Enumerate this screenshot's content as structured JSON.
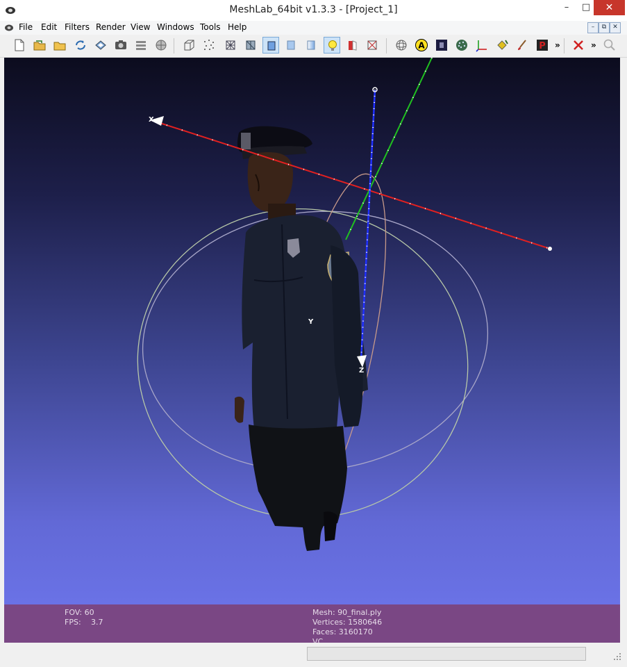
{
  "window": {
    "title": "MeshLab_64bit v1.3.3 - [Project_1]",
    "minimize_label": "–",
    "maximize_label": "□",
    "close_label": "✕"
  },
  "menu": {
    "items": [
      "File",
      "Edit",
      "Filters",
      "Render",
      "View",
      "Windows",
      "Tools",
      "Help"
    ]
  },
  "mdi_controls": [
    "–",
    "⧉",
    "✕"
  ],
  "toolbar": {
    "overflow_label": "»",
    "overflow_label_2": "»",
    "overflow_label_3": "»"
  },
  "viewport": {
    "axis_labels": {
      "x": "X",
      "y": "Y",
      "z": "Z"
    }
  },
  "info": {
    "fov": "FOV: 60",
    "fps_label": "FPS:",
    "fps_value": "3.7",
    "mesh": "Mesh: 90_final.ply",
    "vertices": "Vertices: 1580646",
    "faces": "Faces: 3160170",
    "vc": "VC"
  },
  "colors": {
    "accent_close": "#c7362b",
    "info_bar": "#7a4784",
    "x_axis": "#ff2020",
    "y_axis": "#20c020",
    "z_axis": "#2040ff"
  }
}
